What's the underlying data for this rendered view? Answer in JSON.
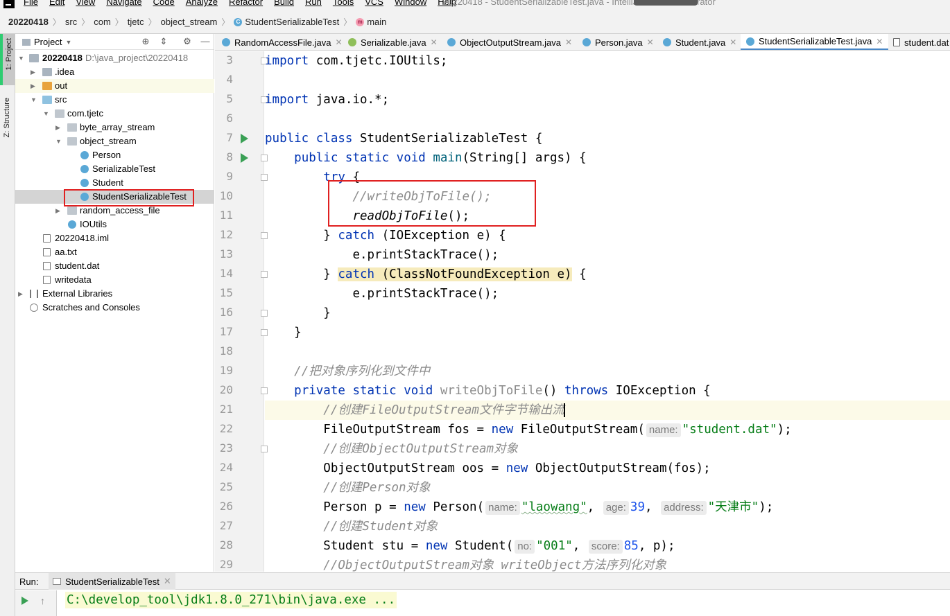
{
  "menubar": {
    "items": [
      "File",
      "Edit",
      "View",
      "Navigate",
      "Code",
      "Analyze",
      "Refactor",
      "Build",
      "Run",
      "Tools",
      "VCS",
      "Window",
      "Help"
    ],
    "window_title": "20220418 - StudentSerializableTest.java - IntelliJ IDEA Administrator"
  },
  "breadcrumb": [
    "20220418",
    "src",
    "com",
    "tjetc",
    "object_stream",
    "StudentSerializableTest",
    "main"
  ],
  "left_stripe": {
    "project": "1: Project",
    "structure": "Z: Structure"
  },
  "project_panel": {
    "title": "Project",
    "tree": [
      {
        "label": "20220418",
        "detail": "D:\\java_project\\20220418"
      },
      {
        "label": ".idea"
      },
      {
        "label": "out"
      },
      {
        "label": "src"
      },
      {
        "label": "com.tjetc"
      },
      {
        "label": "byte_array_stream"
      },
      {
        "label": "object_stream"
      },
      {
        "label": "Person"
      },
      {
        "label": "SerializableTest"
      },
      {
        "label": "Student"
      },
      {
        "label": "StudentSerializableTest"
      },
      {
        "label": "random_access_file"
      },
      {
        "label": "IOUtils"
      },
      {
        "label": "20220418.iml"
      },
      {
        "label": "aa.txt"
      },
      {
        "label": "student.dat"
      },
      {
        "label": "writedata"
      },
      {
        "label": "External Libraries"
      },
      {
        "label": "Scratches and Consoles"
      }
    ]
  },
  "editor_tabs": [
    "RandomAccessFile.java",
    "Serializable.java",
    "ObjectOutputStream.java",
    "Person.java",
    "Student.java",
    "StudentSerializableTest.java",
    "student.dat"
  ],
  "code": {
    "line_numbers": [
      "3",
      "4",
      "5",
      "6",
      "7",
      "8",
      "9",
      "10",
      "11",
      "12",
      "13",
      "14",
      "15",
      "16",
      "17",
      "18",
      "19",
      "20",
      "21",
      "22",
      "23",
      "24",
      "25",
      "26",
      "27",
      "28",
      "29"
    ],
    "t": {
      "import": "import",
      "iou": " com.tjetc.IOUtils;",
      "import2": "import",
      "javaio": " java.io.*;",
      "public": "public",
      "class": "class",
      "clsname": " StudentSerializableTest {",
      "ps": "public static void",
      "main": "main",
      "mainargs": "(String[] args) {",
      "try": "try",
      "tryb": " {",
      "cm10": "//writeObjToFile();",
      "read": "readObjToFile",
      "readp": "();",
      "c12a": "} ",
      "catch1": "catch",
      "c12b": " (IOException e) {",
      "pst": "e.printStackTrace();",
      "c14a": "} ",
      "catch2": "catch",
      "c14b": " (ClassNotFoundException e)",
      "c14c": " {",
      "pst2": "e.printStackTrace();",
      "close16": "}",
      "close17": "}",
      "cm19": "//把对象序列化到文件中",
      "psv": "private static void",
      "wotf": " writeObjToFile",
      "wotfp": "() ",
      "throws": "throws",
      "ioe": " IOException {",
      "cm21": "//创建FileOutputStream文件字节输出流",
      "fos1": "FileOutputStream fos = ",
      "new1": "new",
      "fos2": " FileOutputStream(",
      "h_name1": "name:",
      "s_student": "\"student.dat\"",
      "fos3": ");",
      "cm23": "//创建ObjectOutputStream对象",
      "oos1": "ObjectOutputStream oos = ",
      "new2": "new",
      "oos2": " ObjectOutputStream(fos);",
      "cm25": "//创建Person对象",
      "p1": "Person p = ",
      "new3": "new",
      "p2": " Person(",
      "h_name2": "name:",
      "s_laowang": "\"laowang\"",
      "comma1": ", ",
      "h_age": "age:",
      "n39": "39",
      "comma2": ", ",
      "h_addr": "address:",
      "s_tianjin": "\"天津市\"",
      "p3": ");",
      "cm27": "//创建Student对象",
      "st1": "Student stu = ",
      "new4": "new",
      "st2": " Student(",
      "h_no": "no:",
      "s_001": "\"001\"",
      "comma3": ", ",
      "h_score": "score:",
      "n85": "85",
      "st3": ", p);",
      "cm29": "//ObjectOutputStream对象 writeObject方法序列化对象"
    }
  },
  "run_panel": {
    "label": "Run:",
    "tab": "StudentSerializableTest",
    "command": "C:\\develop_tool\\jdk1.8.0_271\\bin\\java.exe ..."
  },
  "colors": {
    "keyword": "#0033b3",
    "string": "#067d17",
    "number": "#1750eb",
    "comment": "#8c8c8c",
    "highlight_box": "#e02020"
  }
}
